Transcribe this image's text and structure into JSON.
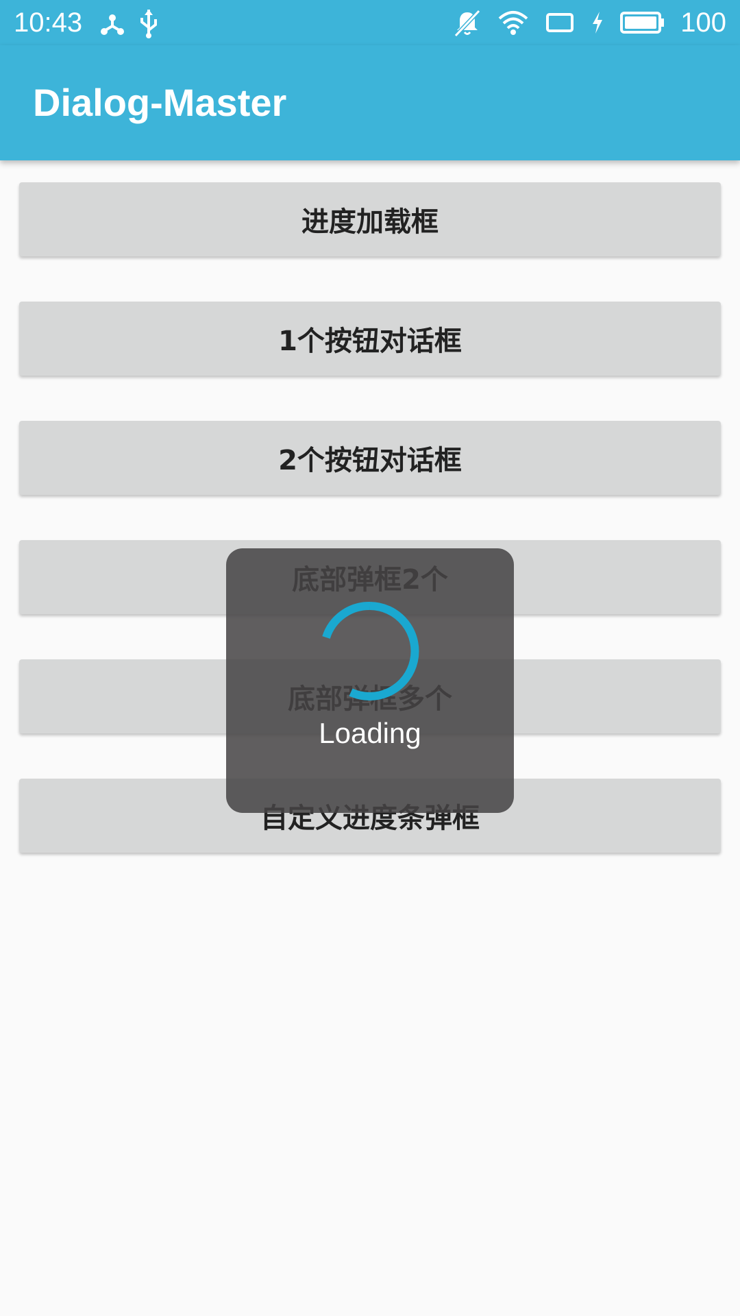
{
  "status_bar": {
    "time": "10:43",
    "battery": "100",
    "left_icons": [
      "share-hub-icon",
      "usb-icon"
    ],
    "right_icons": [
      "mute-bell-icon",
      "wifi-icon",
      "screen-rotate-icon",
      "charging-icon",
      "battery-icon"
    ]
  },
  "app_bar": {
    "title": "Dialog-Master",
    "color": "#3db4d9"
  },
  "buttons": [
    {
      "label": "进度加载框"
    },
    {
      "label": "1个按钮对话框"
    },
    {
      "label": "2个按钮对话框"
    },
    {
      "label": "底部弹框2个"
    },
    {
      "label": "底部弹框多个"
    },
    {
      "label": "自定义进度条弹框"
    }
  ],
  "loading_dialog": {
    "label": "Loading",
    "spinner_color": "#1aa8d0"
  }
}
